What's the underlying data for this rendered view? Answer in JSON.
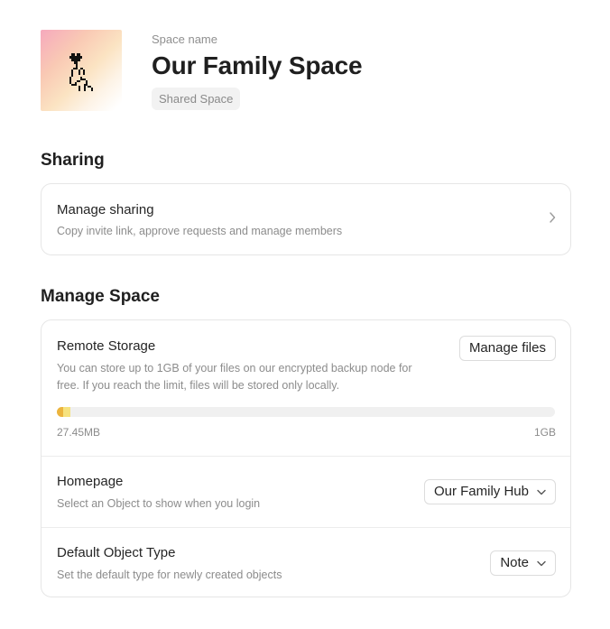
{
  "header": {
    "space_name_label": "Space name",
    "title": "Our Family Space",
    "badge": "Shared Space",
    "icon_name": "hand-heart-icon"
  },
  "sharing": {
    "section_title": "Sharing",
    "manage_sharing": {
      "title": "Manage sharing",
      "description": "Copy invite link, approve requests and manage members",
      "icon_name": "chevron-right-icon"
    }
  },
  "manage_space": {
    "section_title": "Manage Space",
    "remote_storage": {
      "title": "Remote Storage",
      "description_line1": "You can store up to 1GB of your files on our encrypted backup node for",
      "description_line2": "free. If you reach the limit, files will be stored only locally.",
      "button_label": "Manage files",
      "used_label": "27.45MB",
      "limit_label": "1GB",
      "usage_fraction": 0.027,
      "bar_colors": [
        "#ecb43d",
        "#f6e27e"
      ]
    },
    "homepage": {
      "title": "Homepage",
      "description": "Select an Object to show when you login",
      "selected_value": "Our Family Hub",
      "icon_name": "chevron-down-icon"
    },
    "default_object_type": {
      "title": "Default Object Type",
      "description": "Set the default type for newly created objects",
      "selected_value": "Note",
      "icon_name": "chevron-down-icon"
    }
  }
}
